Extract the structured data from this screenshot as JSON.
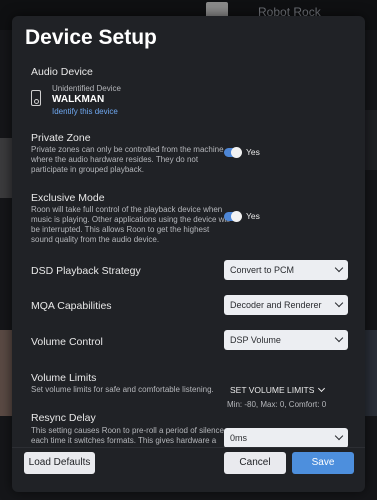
{
  "background": {
    "now_playing_title": "Robot Rock"
  },
  "dialog": {
    "title": "Device Setup",
    "audio_device": {
      "label": "Audio Device",
      "device_type": "Unidentified Device",
      "device_name": "WALKMAN",
      "identify_link": "Identify this device"
    },
    "private_zone": {
      "label": "Private Zone",
      "description": "Private zones can only be controlled from the machine where the audio hardware resides. They do not participate in grouped playback.",
      "value": "Yes",
      "enabled": true
    },
    "exclusive_mode": {
      "label": "Exclusive Mode",
      "description": "Roon will take full control of the playback device when music is playing. Other applications using the device will be interrupted. This allows Roon to get the highest sound quality from the audio device.",
      "value": "Yes",
      "enabled": true
    },
    "dsd_strategy": {
      "label": "DSD Playback Strategy",
      "value": "Convert to PCM"
    },
    "mqa": {
      "label": "MQA Capabilities",
      "value": "Decoder and Renderer"
    },
    "volume_control": {
      "label": "Volume Control",
      "value": "DSP Volume"
    },
    "volume_limits": {
      "label": "Volume Limits",
      "description": "Set volume limits for safe and comfortable listening.",
      "button": "SET VOLUME LIMITS",
      "summary": "Min: -80, Max: 0, Comfort: 0"
    },
    "resync_delay": {
      "label": "Resync Delay",
      "description": "This setting causes Roon to pre-roll a period of silence each time it switches formats. This gives hardware a",
      "value": "0ms"
    },
    "buttons": {
      "load_defaults": "Load Defaults",
      "cancel": "Cancel",
      "save": "Save"
    },
    "colors": {
      "accent": "#4d8fdd",
      "dialog_bg": "#202226",
      "link": "#6fa8f0"
    }
  }
}
